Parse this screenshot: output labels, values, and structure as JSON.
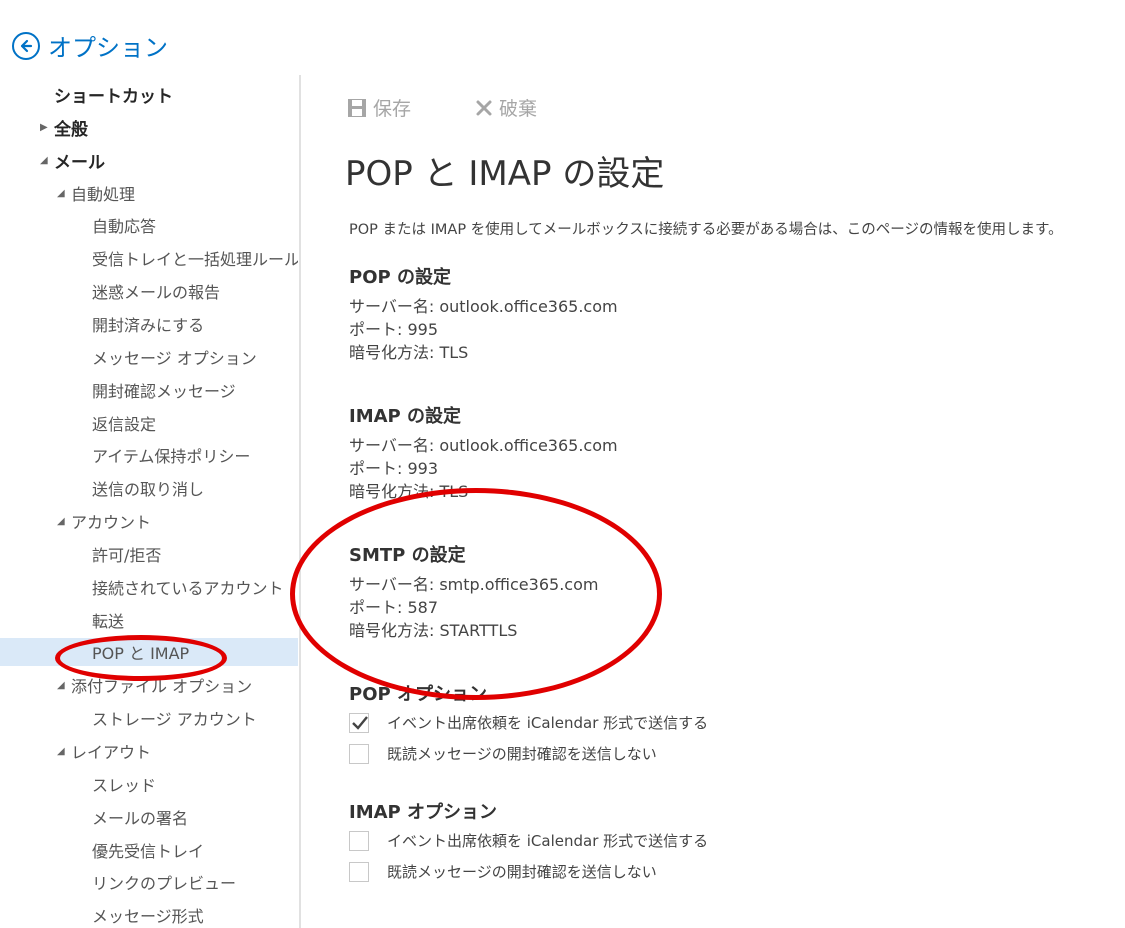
{
  "header": {
    "title": "オプション"
  },
  "colors": {
    "accent": "#0072c6",
    "selected_bg": "#dae9f8",
    "annotation": "#e00000"
  },
  "sidebar": {
    "items": [
      {
        "label": "ショートカット",
        "level": "top",
        "arrow": ""
      },
      {
        "label": "全般",
        "level": "top",
        "arrow": "▶"
      },
      {
        "label": "メール",
        "level": "top",
        "arrow": "◢"
      },
      {
        "label": "自動処理",
        "level": "sub",
        "arrow": "◢"
      },
      {
        "label": "自動応答",
        "level": "leaf"
      },
      {
        "label": "受信トレイと一括処理ルール",
        "level": "leaf"
      },
      {
        "label": "迷惑メールの報告",
        "level": "leaf"
      },
      {
        "label": "開封済みにする",
        "level": "leaf"
      },
      {
        "label": "メッセージ オプション",
        "level": "leaf"
      },
      {
        "label": "開封確認メッセージ",
        "level": "leaf"
      },
      {
        "label": "返信設定",
        "level": "leaf"
      },
      {
        "label": "アイテム保持ポリシー",
        "level": "leaf"
      },
      {
        "label": "送信の取り消し",
        "level": "leaf"
      },
      {
        "label": "アカウント",
        "level": "sub",
        "arrow": "◢"
      },
      {
        "label": "許可/拒否",
        "level": "leaf"
      },
      {
        "label": "接続されているアカウント",
        "level": "leaf"
      },
      {
        "label": "転送",
        "level": "leaf"
      },
      {
        "label": "POP と IMAP",
        "level": "leaf",
        "selected": true
      },
      {
        "label": "添付ファイル オプション",
        "level": "sub",
        "arrow": "◢"
      },
      {
        "label": "ストレージ アカウント",
        "level": "leaf"
      },
      {
        "label": "レイアウト",
        "level": "sub",
        "arrow": "◢"
      },
      {
        "label": "スレッド",
        "level": "leaf"
      },
      {
        "label": "メールの署名",
        "level": "leaf"
      },
      {
        "label": "優先受信トレイ",
        "level": "leaf"
      },
      {
        "label": "リンクのプレビュー",
        "level": "leaf"
      },
      {
        "label": "メッセージ形式",
        "level": "leaf"
      }
    ]
  },
  "toolbar": {
    "save_label": "保存",
    "discard_label": "破棄"
  },
  "page": {
    "title": "POP と IMAP の設定",
    "description": "POP または IMAP を使用してメールボックスに接続する必要がある場合は、このページの情報を使用します。"
  },
  "pop": {
    "title": "POP の設定",
    "server": "サーバー名: outlook.office365.com",
    "port": "ポート: 995",
    "encryption": "暗号化方法: TLS"
  },
  "imap": {
    "title": "IMAP の設定",
    "server": "サーバー名: outlook.office365.com",
    "port": "ポート: 993",
    "encryption": "暗号化方法: TLS"
  },
  "smtp": {
    "title": "SMTP の設定",
    "server": "サーバー名: smtp.office365.com",
    "port": "ポート: 587",
    "encryption": "暗号化方法: STARTTLS"
  },
  "pop_options": {
    "title": "POP オプション",
    "items": [
      {
        "label": "イベント出席依頼を iCalendar 形式で送信する",
        "checked": true
      },
      {
        "label": "既読メッセージの開封確認を送信しない",
        "checked": false
      }
    ]
  },
  "imap_options": {
    "title": "IMAP オプション",
    "items": [
      {
        "label": "イベント出席依頼を iCalendar 形式で送信する",
        "checked": false
      },
      {
        "label": "既読メッセージの開封確認を送信しない",
        "checked": false
      }
    ]
  }
}
